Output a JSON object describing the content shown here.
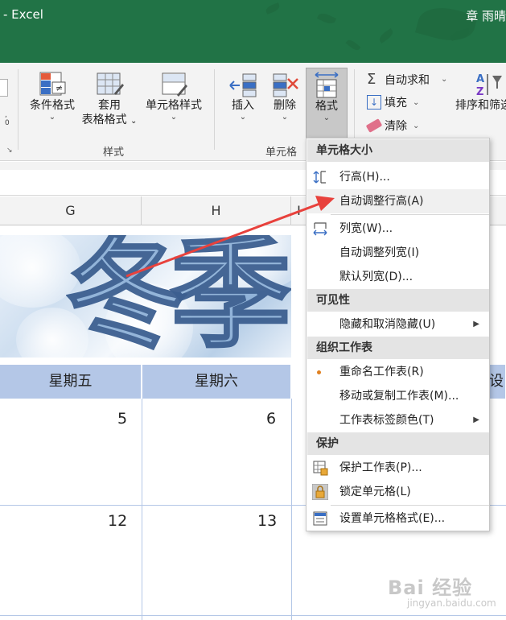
{
  "titlebar": {
    "app_title": "- Excel",
    "user": "章 雨晴"
  },
  "ribbon": {
    "styles_group": {
      "label": "样式",
      "conditional_format": "条件格式",
      "table_format_line1": "套用",
      "table_format_line2": "表格格式",
      "cell_styles": "单元格样式"
    },
    "cells_group": {
      "label": "单元格",
      "insert": "插入",
      "delete": "删除",
      "format": "格式"
    },
    "editing_group": {
      "autosum": "自动求和",
      "fill": "填充",
      "clear": "清除",
      "sort_filter": "排序和筛选"
    }
  },
  "columns": {
    "g": "G",
    "h": "H",
    "i": "I"
  },
  "banner_text": {
    "char1": "冬",
    "char2": "季"
  },
  "calendar": {
    "friday": "星期五",
    "saturday": "星期六",
    "partial_header": "设",
    "row1": [
      "5",
      "6"
    ],
    "row2": [
      "12",
      "13"
    ]
  },
  "menu": {
    "cell_size": {
      "header": "单元格大小",
      "row_height": "行高(H)...",
      "autofit_row": "自动调整行高(A)",
      "col_width": "列宽(W)...",
      "autofit_col": "自动调整列宽(I)",
      "default_width": "默认列宽(D)..."
    },
    "visibility": {
      "header": "可见性",
      "hide_unhide": "隐藏和取消隐藏(U)"
    },
    "organize": {
      "header": "组织工作表",
      "rename": "重命名工作表(R)",
      "move_copy": "移动或复制工作表(M)...",
      "tab_color": "工作表标签颜色(T)"
    },
    "protection": {
      "header": "保护",
      "protect_sheet": "保护工作表(P)...",
      "lock_cell": "锁定单元格(L)",
      "format_cells": "设置单元格格式(E)..."
    }
  },
  "watermark": {
    "main": "Bai 经验",
    "sub": "jingyan.baidu.com"
  },
  "colors": {
    "excel_green": "#217346",
    "arrow_red": "#e8413c",
    "header_blue": "#b4c7e7"
  }
}
